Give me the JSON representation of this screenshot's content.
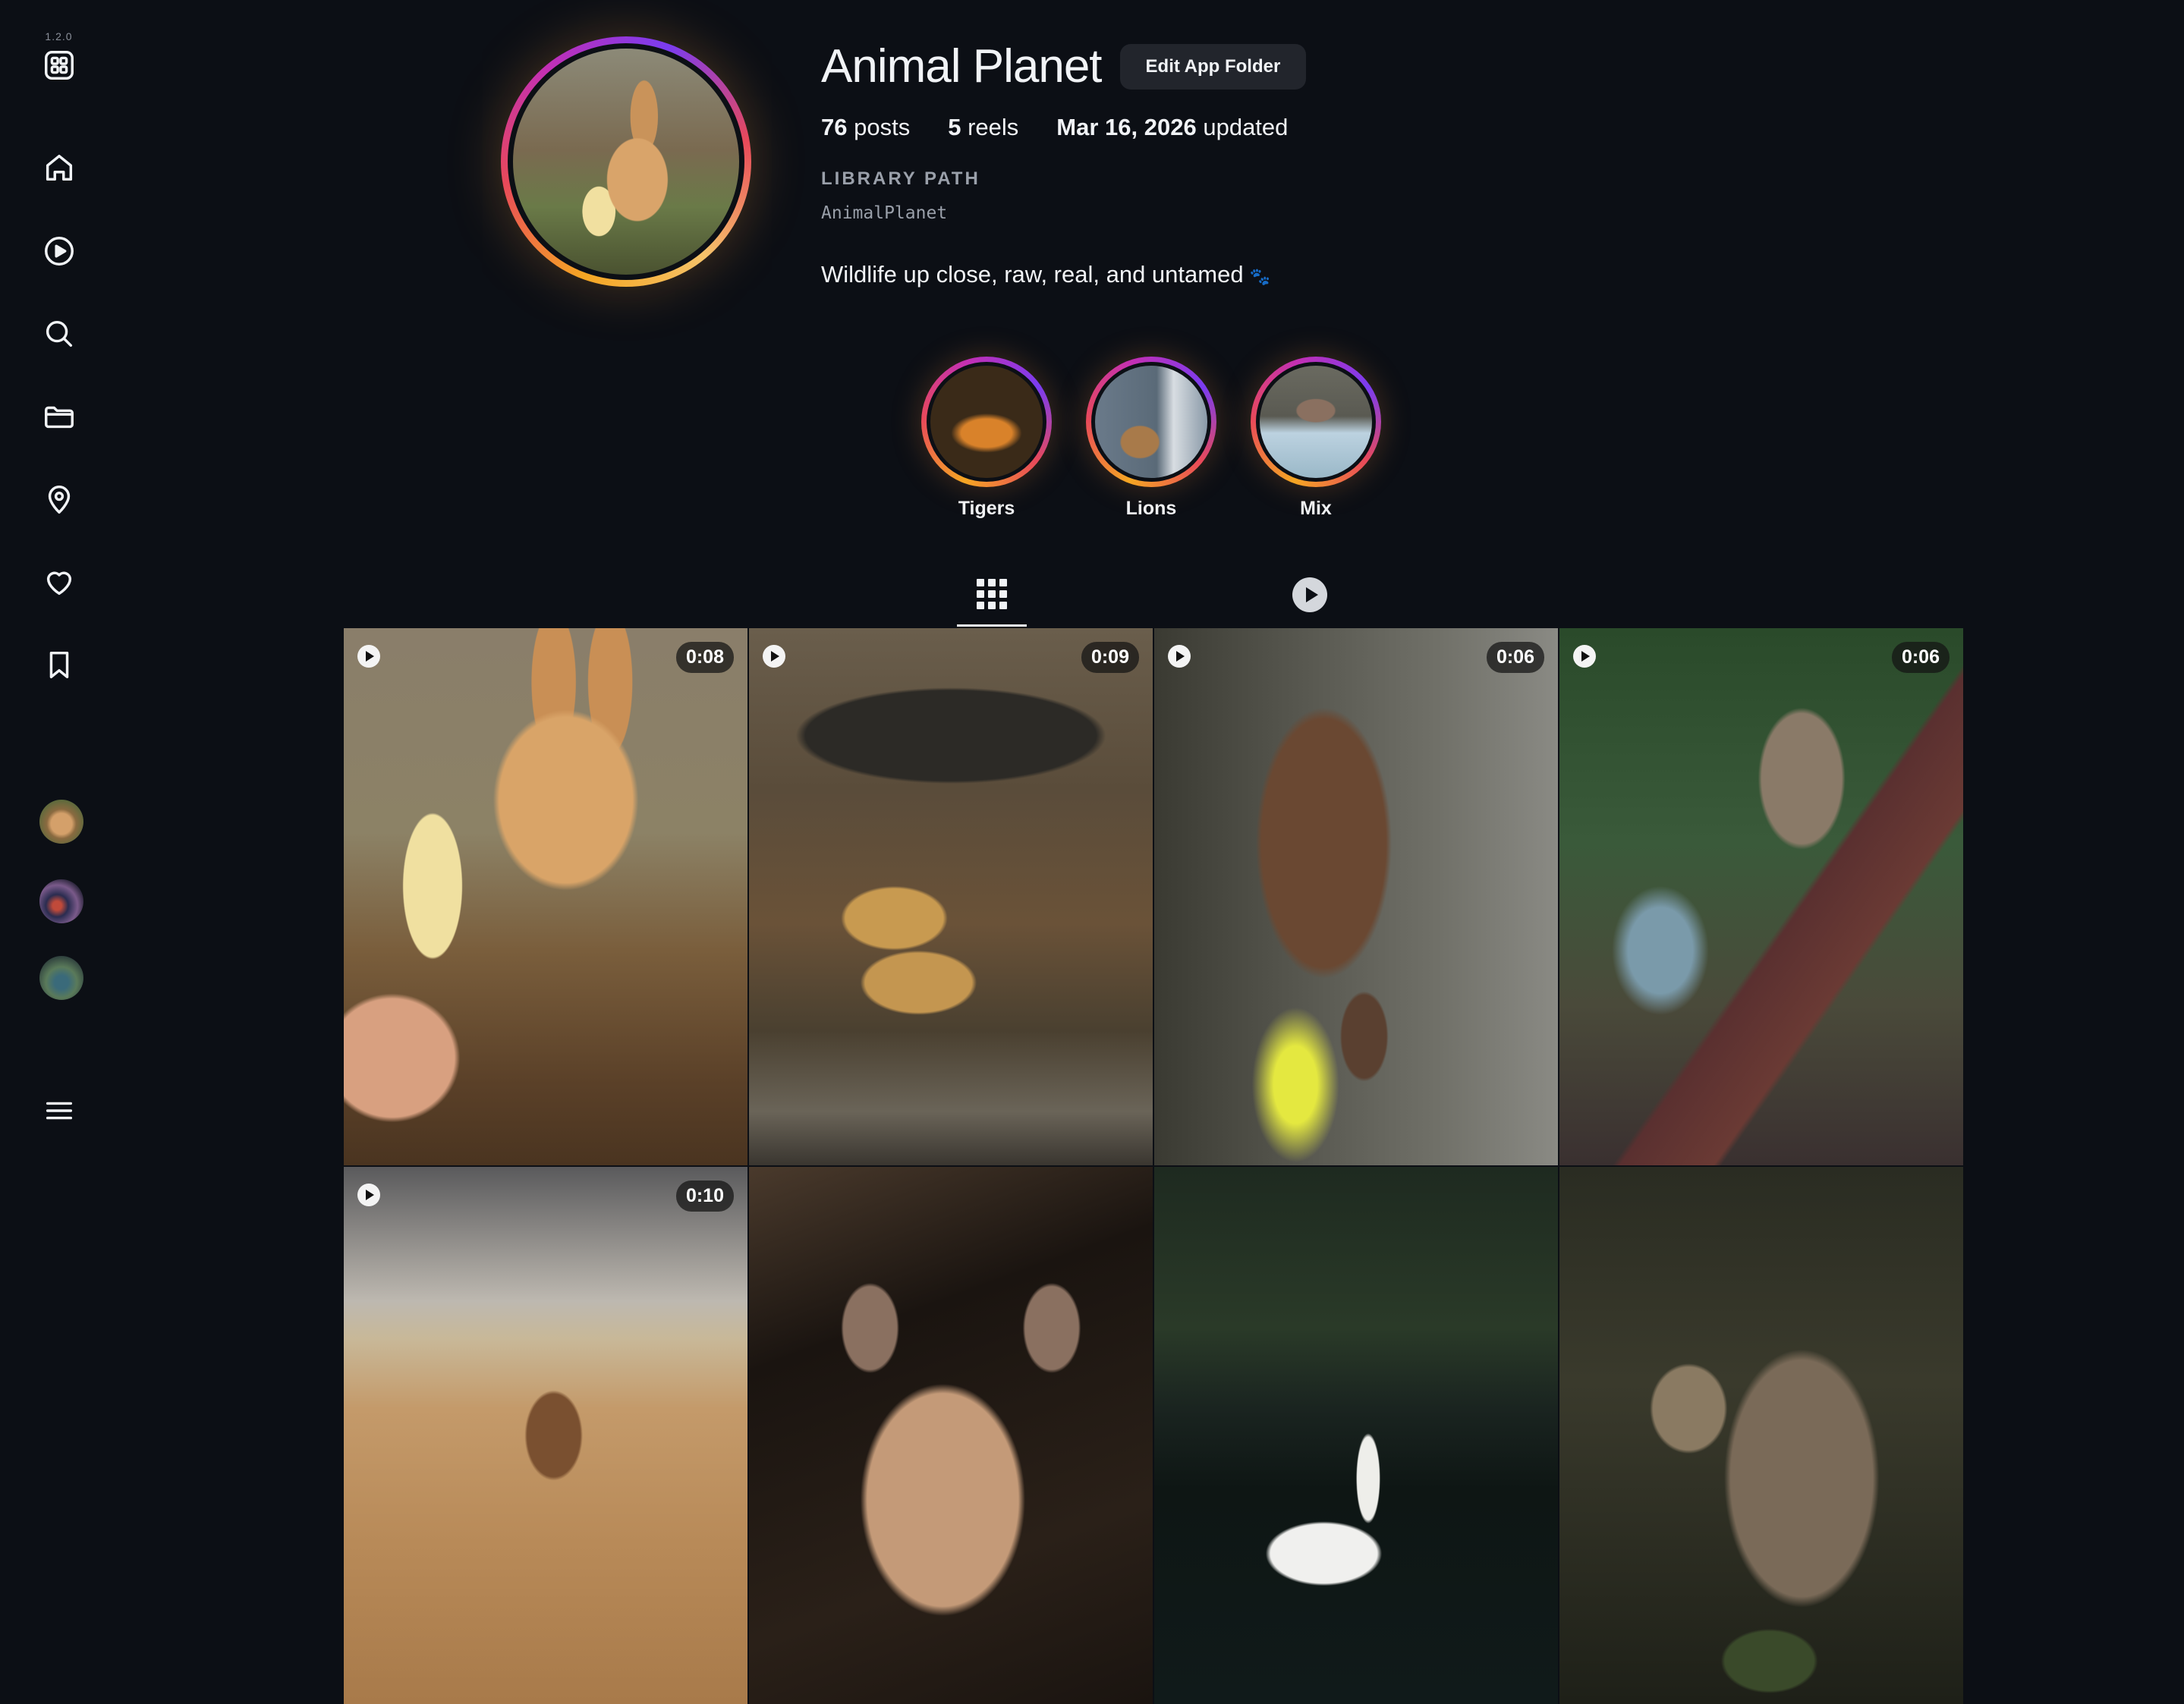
{
  "app": {
    "version": "1.2.0"
  },
  "sidebar": {
    "items": [
      {
        "name": "apps",
        "icon": "apps-grid-icon"
      },
      {
        "name": "home",
        "icon": "home-icon"
      },
      {
        "name": "reels",
        "icon": "play-circle-icon"
      },
      {
        "name": "search",
        "icon": "search-icon"
      },
      {
        "name": "folders",
        "icon": "folder-icon"
      },
      {
        "name": "places",
        "icon": "location-pin-icon"
      },
      {
        "name": "favorites",
        "icon": "heart-icon"
      },
      {
        "name": "saved",
        "icon": "bookmark-icon"
      },
      {
        "name": "menu",
        "icon": "hamburger-menu-icon"
      }
    ]
  },
  "profile": {
    "name": "Animal Planet",
    "edit_button": "Edit App Folder",
    "stats": {
      "posts_count": "76",
      "posts_label": "posts",
      "reels_count": "5",
      "reels_label": "reels",
      "updated_date": "Mar 16, 2026",
      "updated_label": "updated"
    },
    "library_label": "LIBRARY PATH",
    "library_path": "AnimalPlanet",
    "bio": "Wildlife up close, raw, real, and untamed",
    "bio_emoji": "🐾"
  },
  "highlights": [
    {
      "label": "Tigers"
    },
    {
      "label": "Lions"
    },
    {
      "label": "Mix"
    }
  ],
  "tabs": [
    {
      "name": "posts-grid",
      "icon": "grid-icon",
      "active": true
    },
    {
      "name": "reels",
      "icon": "play-circle-icon",
      "active": false
    }
  ],
  "posts": [
    {
      "subject": "rabbit eating banana",
      "is_video": true,
      "duration": "0:08"
    },
    {
      "subject": "leopards and crocodile near buffalo",
      "is_video": true,
      "duration": "0:09"
    },
    {
      "subject": "spotted deer grazing",
      "is_video": true,
      "duration": "0:06"
    },
    {
      "subject": "squirrel on tree branch",
      "is_video": true,
      "duration": "0:06"
    },
    {
      "subject": "camel in desert",
      "is_video": true,
      "duration": "0:10"
    },
    {
      "subject": "cougar portrait",
      "is_video": false,
      "duration": ""
    },
    {
      "subject": "white swan on dark water",
      "is_video": false,
      "duration": ""
    },
    {
      "subject": "lynx on rock",
      "is_video": false,
      "duration": ""
    }
  ],
  "colors": {
    "background": "#0c0f15",
    "text": "#f1f3f6",
    "muted": "#9aa0aa",
    "ring_gradient": [
      "#f5a623",
      "#e8495a",
      "#c22fb5",
      "#7a3cf0"
    ]
  }
}
